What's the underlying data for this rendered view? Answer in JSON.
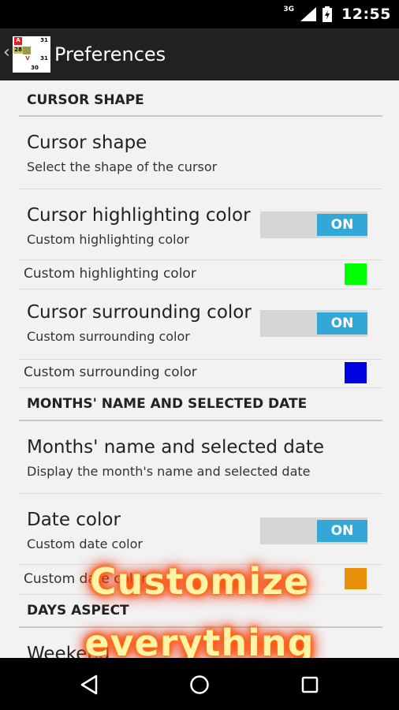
{
  "status_bar": {
    "network": "3G",
    "time": "12:55"
  },
  "action_bar": {
    "title": "Preferences",
    "app_icon_cells": [
      "A",
      "31",
      "28",
      "V",
      "31",
      "30"
    ]
  },
  "sections": {
    "cursor_shape": {
      "header": "CURSOR SHAPE",
      "shape_pref": {
        "title": "Cursor shape",
        "summary": "Select the shape of the cursor"
      },
      "highlight_pref": {
        "title": "Cursor highlighting color",
        "summary": "Custom highlighting color",
        "toggle": "ON",
        "sub_label": "Custom highlighting color",
        "swatch_color": "#00ff00"
      },
      "surround_pref": {
        "title": "Cursor surrounding color",
        "summary": "Custom surrounding color",
        "toggle": "ON",
        "sub_label": "Custom surrounding color",
        "swatch_color": "#0000e0"
      }
    },
    "months": {
      "header": "MONTHS' NAME AND SELECTED DATE",
      "name_pref": {
        "title": "Months' name and selected date",
        "summary": "Display the month's name and selected date"
      },
      "date_color_pref": {
        "title": "Date color",
        "summary": "Custom date color",
        "toggle": "ON",
        "sub_label": "Custom date color",
        "swatch_color": "#e8900a"
      }
    },
    "days_aspect": {
      "header": "DAYS ASPECT",
      "partial_title": "Weekend"
    }
  },
  "promo": {
    "line1": "Customize",
    "line2": "everything"
  },
  "colors": {
    "toggle_on": "#33a8d6",
    "action_bar": "#212121",
    "promo_glow": "#ff6a00"
  },
  "nav_bar": {
    "back_icon": "triangle-back-icon",
    "home_icon": "circle-home-icon",
    "recents_icon": "square-recents-icon"
  }
}
